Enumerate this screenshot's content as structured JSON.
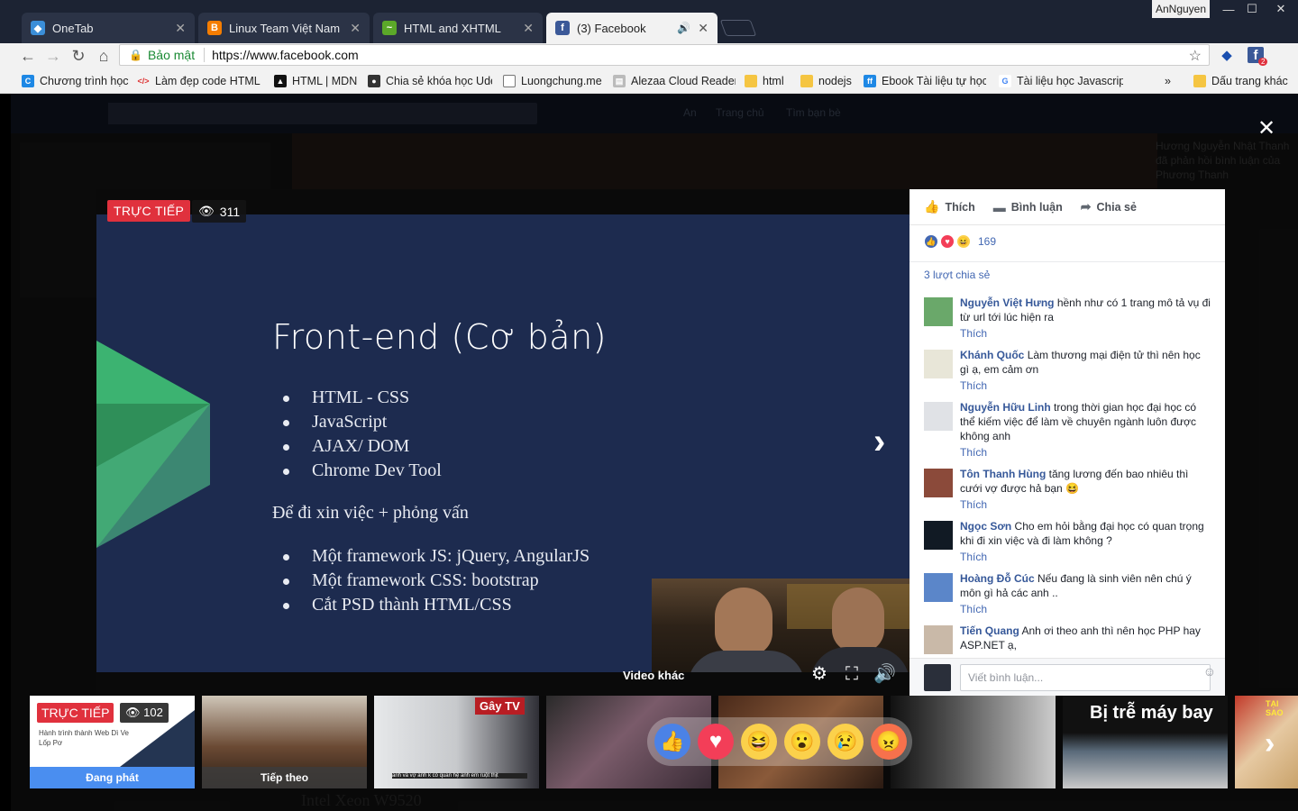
{
  "browser": {
    "tabs": [
      {
        "label": "OneTab"
      },
      {
        "label": "Linux Team Việt Nam Are"
      },
      {
        "label": "HTML and XHTML"
      },
      {
        "label": "(3) Facebook"
      }
    ],
    "user": "AnNguyen",
    "address": {
      "secure_label": "Bảo mật",
      "url": "https://www.facebook.com"
    },
    "extension_badge": "2",
    "bookmarks": [
      {
        "label": "Chương trình học"
      },
      {
        "label": "Làm đẹp code HTML"
      },
      {
        "label": "HTML | MDN"
      },
      {
        "label": "Chia sẻ khóa học Ude"
      },
      {
        "label": "Luongchung.me"
      },
      {
        "label": "Alezaa Cloud Reader"
      },
      {
        "label": "html"
      },
      {
        "label": "nodejs"
      },
      {
        "label": "Ebook Tài liệu tự học"
      },
      {
        "label": "Tài liệu học Javascript"
      }
    ],
    "bookmarks_more": "»",
    "other_bookmarks": "Dấu trang khác"
  },
  "background_page": {
    "nav": [
      "An",
      "Trang chủ",
      "Tìm bạn bè"
    ],
    "side_text": "Hương Nguyễn Nhật Thanh đã phản hồi bình luận của Phương Thanh",
    "bottom_text": "Intel Xeon W9520"
  },
  "video": {
    "live_label": "TRỰC TIẾP",
    "viewers": "311",
    "more_videos": "Video khác",
    "slide": {
      "title": "Front-end (Cơ bản)",
      "list1": [
        "HTML - CSS",
        "JavaScript",
        "AJAX/ DOM",
        "Chrome Dev Tool"
      ],
      "subtitle": "Để đi xin việc + phỏng vấn",
      "list2": [
        "Một framework JS: jQuery, AngularJS",
        "Một framework CSS: bootstrap",
        "Cắt PSD thành HTML/CSS"
      ]
    }
  },
  "panel": {
    "actions": {
      "like": "Thích",
      "comment": "Bình luận",
      "share": "Chia sẻ"
    },
    "reactions_count": "169",
    "shares": "3 lượt chia sẻ",
    "like_label": "Thích",
    "comments": [
      {
        "name": "Nguyễn Việt Hưng",
        "text": "hềnh như có 1 trang mô tả vụ đi từ url tới lúc hiện ra"
      },
      {
        "name": "Khánh Quốc",
        "text": "Làm thương mại điện tử thì nên học gì ạ, em cảm ơn"
      },
      {
        "name": "Nguyễn Hữu Linh",
        "text": "trong thời gian học đại học có thể kiếm việc để làm về chuyên ngành luôn được không anh"
      },
      {
        "name": "Tôn Thanh Hùng",
        "text": "tăng lương đến bao nhiêu thì cưới vợ được hả bạn 😆"
      },
      {
        "name": "Ngọc Sơn",
        "text": "Cho em hỏi bằng đại học có quan trọng khi đi xin việc và đi làm không ?"
      },
      {
        "name": "Hoàng Đỗ Cúc",
        "text": "Nếu đang là sinh viên nên chú ý môn gì hả các anh .."
      },
      {
        "name": "Tiến Quang",
        "text": "Anh ơi theo anh thì nên học PHP hay ASP.NET ạ,"
      }
    ],
    "compose_placeholder": "Viết bình luận..."
  },
  "thumbnails": [
    {
      "live": "TRỰC TIẾP",
      "views": "102",
      "subtitle": "Hành trình thành Web Dì Ve Lốp Pơ",
      "caption": "Đang phát"
    },
    {
      "caption": "Tiếp theo"
    },
    {
      "logo": "Gây TV",
      "subtitle": "anh và vợ anh k có quan hệ anh em ruột thịt"
    },
    {
      "caption": ""
    },
    {
      "caption": ""
    },
    {
      "title": "Bị trễ máy bay"
    },
    {
      "tag": "TẠI SAO"
    }
  ],
  "colors": {
    "live_red": "#e0313d",
    "fb_blue": "#4267b2",
    "slide_bg": "#1d2b4f",
    "accent_green": "#3cb371"
  },
  "icons": [
    "onetab-icon",
    "blogger-icon",
    "html-icon",
    "facebook-icon",
    "back-icon",
    "forward-icon",
    "reload-icon",
    "home-icon",
    "lock-icon",
    "star-icon",
    "close-icon",
    "eye-icon",
    "settings-icon",
    "fullscreen-icon",
    "volume-icon",
    "chevron-right-icon",
    "like-icon",
    "comment-icon",
    "share-icon",
    "emoji-icon"
  ],
  "reactions": [
    "like",
    "love",
    "haha",
    "wow",
    "sad",
    "angry"
  ]
}
